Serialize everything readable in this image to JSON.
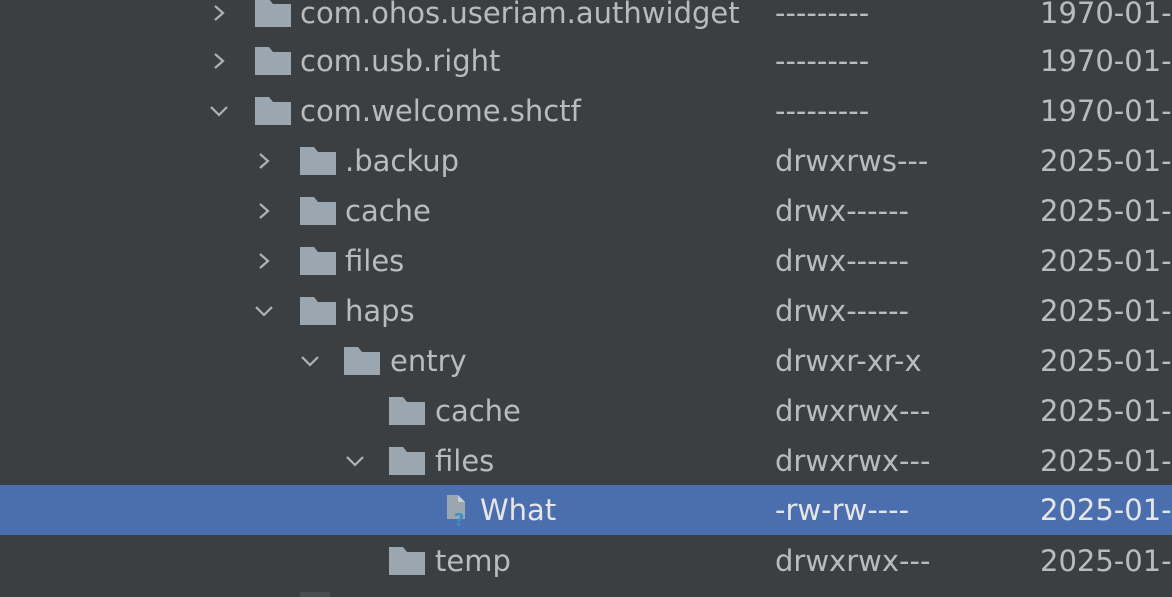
{
  "file_tree": {
    "rows": [
      {
        "name": "com.ohos.useriam.authwidget",
        "permissions": "---------",
        "date": "1970-01-"
      },
      {
        "name": "com.usb.right",
        "permissions": "---------",
        "date": "1970-01-"
      },
      {
        "name": "com.welcome.shctf",
        "permissions": "---------",
        "date": "1970-01-"
      },
      {
        "name": ".backup",
        "permissions": "drwxrws---",
        "date": "2025-01-"
      },
      {
        "name": "cache",
        "permissions": "drwx------",
        "date": "2025-01-"
      },
      {
        "name": "files",
        "permissions": "drwx------",
        "date": "2025-01-"
      },
      {
        "name": "haps",
        "permissions": "drwx------",
        "date": "2025-01-"
      },
      {
        "name": "entry",
        "permissions": "drwxr-xr-x",
        "date": "2025-01-"
      },
      {
        "name": "cache",
        "permissions": "drwxrwx---",
        "date": "2025-01-"
      },
      {
        "name": "files",
        "permissions": "drwxrwx---",
        "date": "2025-01-"
      },
      {
        "name": "What",
        "permissions": "-rw-rw----",
        "date": "2025-01-"
      },
      {
        "name": "temp",
        "permissions": "drwxrwx---",
        "date": "2025-01-"
      }
    ]
  },
  "colors": {
    "background": "#3c3f41",
    "selection": "#4b6eaf",
    "text": "#bbbbbb",
    "folder_icon": "#9aa7b0",
    "unknown_file_accent": "#3592c4"
  }
}
